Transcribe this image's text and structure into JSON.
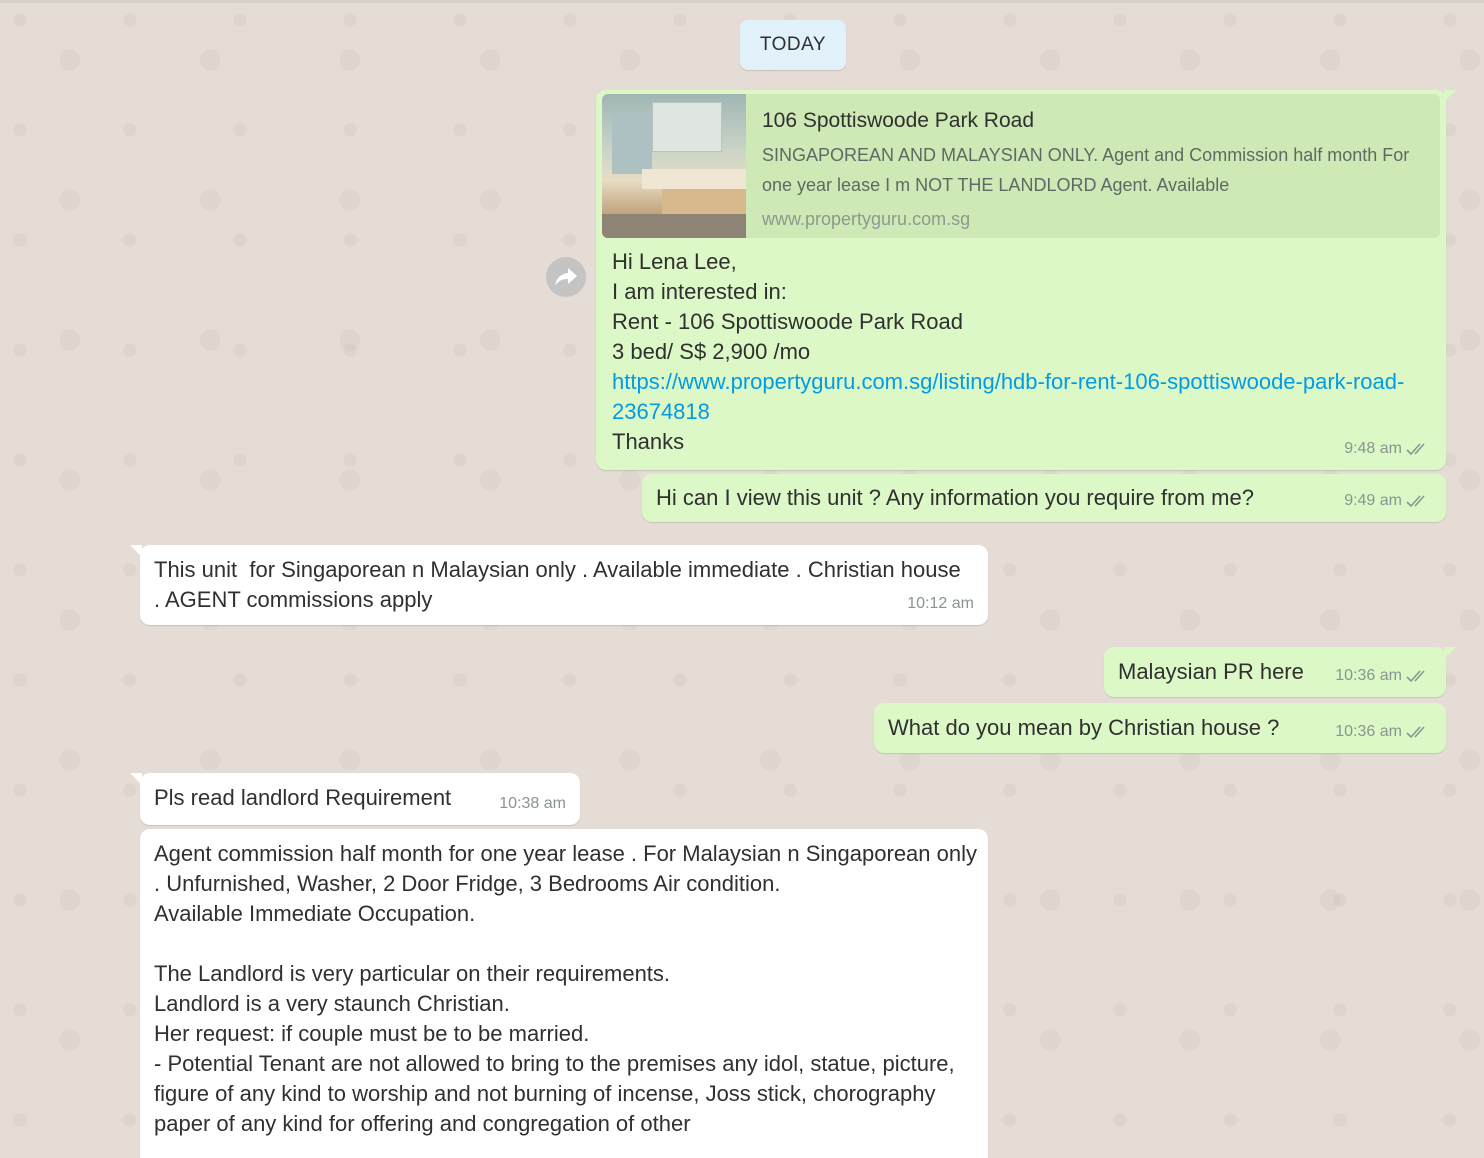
{
  "date_chip": "TODAY",
  "messages": {
    "m1": {
      "preview": {
        "title": "106 Spottiswoode Park Road",
        "description": "SINGAPOREAN AND MALAYSIAN ONLY. Agent and Commission half month For one year lease I m NOT THE LANDLORD Agent. Available",
        "site": "www.propertyguru.com.sg"
      },
      "line1": "Hi Lena Lee,",
      "line2": "I am interested in:",
      "line3": "Rent - 106 Spottiswoode Park Road",
      "line4": "3 bed/ S$ 2,900 /mo",
      "link": "https://www.propertyguru.com.sg/listing/hdb-for-rent-106-spottiswoode-park-road-23674818",
      "line5": "Thanks",
      "time": "9:48 am"
    },
    "m2": {
      "text": "Hi can I view this unit ? Any information you require from me?",
      "time": "9:49 am"
    },
    "m3": {
      "text": "This unit  for Singaporean n Malaysian only . Available immediate . Christian house  . AGENT commissions apply",
      "time": "10:12 am"
    },
    "m4": {
      "text": "Malaysian PR here",
      "time": "10:36 am"
    },
    "m5": {
      "text": "What do you mean by Christian house ?",
      "time": "10:36 am"
    },
    "m6": {
      "text": "Pls read landlord Requirement",
      "time": "10:38 am"
    },
    "m7": {
      "text": "Agent commission half month for one year lease . For Malaysian n Singaporean only . Unfurnished, Washer, 2 Door Fridge, 3 Bedrooms Air condition.\nAvailable Immediate Occupation.\n\nThe Landlord is very particular on their requirements.\nLandlord is a very staunch Christian.\nHer request: if couple must be to be married.\n- Potential Tenant are not allowed to bring to the premises any idol, statue, picture, figure of any kind to worship and not burning of incense, Joss stick, chorography paper of any kind for offering and congregation of other"
    }
  },
  "icons": {
    "forward": "forward-arrow-icon",
    "read_receipt": "double-check-icon",
    "thumbnail": "kitchen-photo"
  },
  "colors": {
    "background": "#e5ddd5",
    "outgoing": "#dcf8c6",
    "incoming": "#ffffff",
    "link": "#039be5",
    "date_chip": "#e1f2fb"
  }
}
